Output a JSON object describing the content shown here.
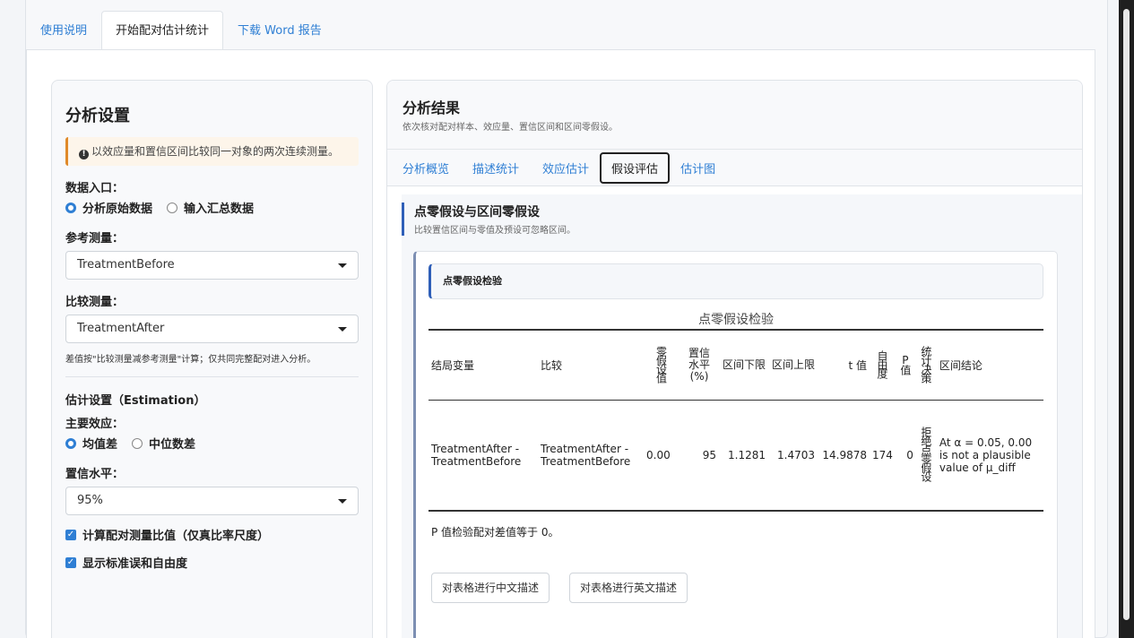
{
  "top_tabs": [
    {
      "label": "使用说明"
    },
    {
      "label": "开始配对估计统计"
    },
    {
      "label": "下载 Word 报告"
    }
  ],
  "settings": {
    "title": "分析设置",
    "note": "以效应量和置信区间比较同一对象的两次连续测量。",
    "data_entry_label": "数据入口：",
    "data_entry_options": [
      "分析原始数据",
      "输入汇总数据"
    ],
    "data_entry_selected": "分析原始数据",
    "reference_label": "参考测量：",
    "reference_value": "TreatmentBefore",
    "compare_label": "比较测量：",
    "compare_value": "TreatmentAfter",
    "hint": "差值按\"比较测量减参考测量\"计算；仅共同完整配对进入分析。",
    "estimation_label": "估计设置（Estimation）",
    "effect_label": "主要效应：",
    "effect_options": [
      "均值差",
      "中位数差"
    ],
    "effect_selected": "均值差",
    "conf_label": "置信水平：",
    "conf_value": "95%",
    "check_ratio": "计算配对测量比值（仅真比率尺度）",
    "check_se": "显示标准误和自由度"
  },
  "results": {
    "title": "分析结果",
    "subtitle": "依次核对配对样本、效应量、置信区间和区间零假设。",
    "tabs": [
      "分析概览",
      "描述统计",
      "效应估计",
      "假设评估",
      "估计图"
    ],
    "active_tab": "假设评估",
    "section_title": "点零假设与区间零假设",
    "section_sub": "比较置信区间与零值及预设可忽略区间。",
    "card_title": "点零假设检验",
    "table_caption": "点零假设检验",
    "columns": {
      "outcome": "结局变量",
      "compare": "比较",
      "null": "零假设值",
      "conf": "置信水平(%)",
      "lower": "区间下限",
      "upper": "区间上限",
      "t": "t 值",
      "df": "自由度",
      "p": "P值",
      "decision": "统计决策",
      "conclusion": "区间结论"
    },
    "rows": [
      {
        "outcome": "TreatmentAfter - TreatmentBefore",
        "compare": "TreatmentAfter - TreatmentBefore",
        "null": "0.00",
        "conf": "95",
        "lower": "1.1281",
        "upper": "1.4703",
        "t": "14.9878",
        "df": "174",
        "p": "0",
        "decision": "拒绝点零假设",
        "conclusion": "At α = 0.05, 0.00 is not a plausible value of μ_diff"
      }
    ],
    "footnote": "P 值检验配对差值等于 0。",
    "btn_cn": "对表格进行中文描述",
    "btn_en": "对表格进行英文描述"
  }
}
